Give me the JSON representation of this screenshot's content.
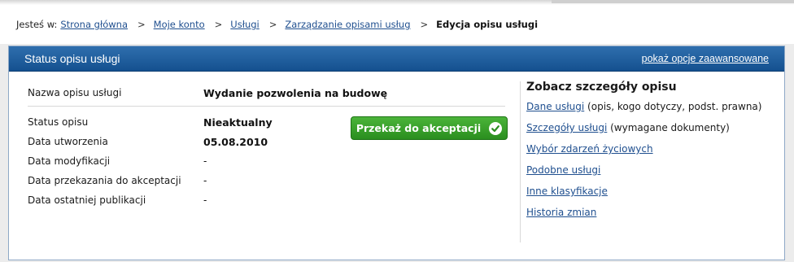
{
  "breadcrumb": {
    "prefix": "Jesteś w:",
    "links": [
      "Strona główna",
      "Moje konto",
      "Usługi",
      "Zarządzanie opisami usług"
    ],
    "separator": ">",
    "current": "Edycja opisu usługi"
  },
  "panel": {
    "title": "Status opisu usługi",
    "advanced_link": "pokaż opcje zaawansowane"
  },
  "info": {
    "name_label": "Nazwa opisu usługi",
    "name_value": "Wydanie pozwolenia na budowę",
    "rows": [
      {
        "label": "Status opisu",
        "value": "Nieaktualny"
      },
      {
        "label": "Data utworzenia",
        "value": "05.08.2010"
      },
      {
        "label": "Data modyfikacji",
        "value": "-"
      },
      {
        "label": "Data przekazania do akceptacji",
        "value": "-"
      },
      {
        "label": "Data ostatniej publikacji",
        "value": "-"
      }
    ]
  },
  "actions": {
    "accept_label": "Przekaż do akceptacji",
    "accept_icon": "check-circle-icon"
  },
  "details": {
    "title": "Zobacz szczegóły opisu",
    "items": [
      {
        "link": "Dane usługi",
        "desc": " (opis, kogo dotyczy, podst. prawna)"
      },
      {
        "link": "Szczegóły usługi",
        "desc": " (wymagane dokumenty)"
      },
      {
        "link": "Wybór zdarzeń życiowych",
        "desc": ""
      },
      {
        "link": "Podobne usługi",
        "desc": ""
      },
      {
        "link": "Inne klasyfikacje",
        "desc": ""
      },
      {
        "link": "Historia zmian",
        "desc": ""
      }
    ]
  },
  "colors": {
    "header_blue": "#1a5b9c",
    "link_blue": "#1f4f8f",
    "button_green": "#3aa22b"
  }
}
